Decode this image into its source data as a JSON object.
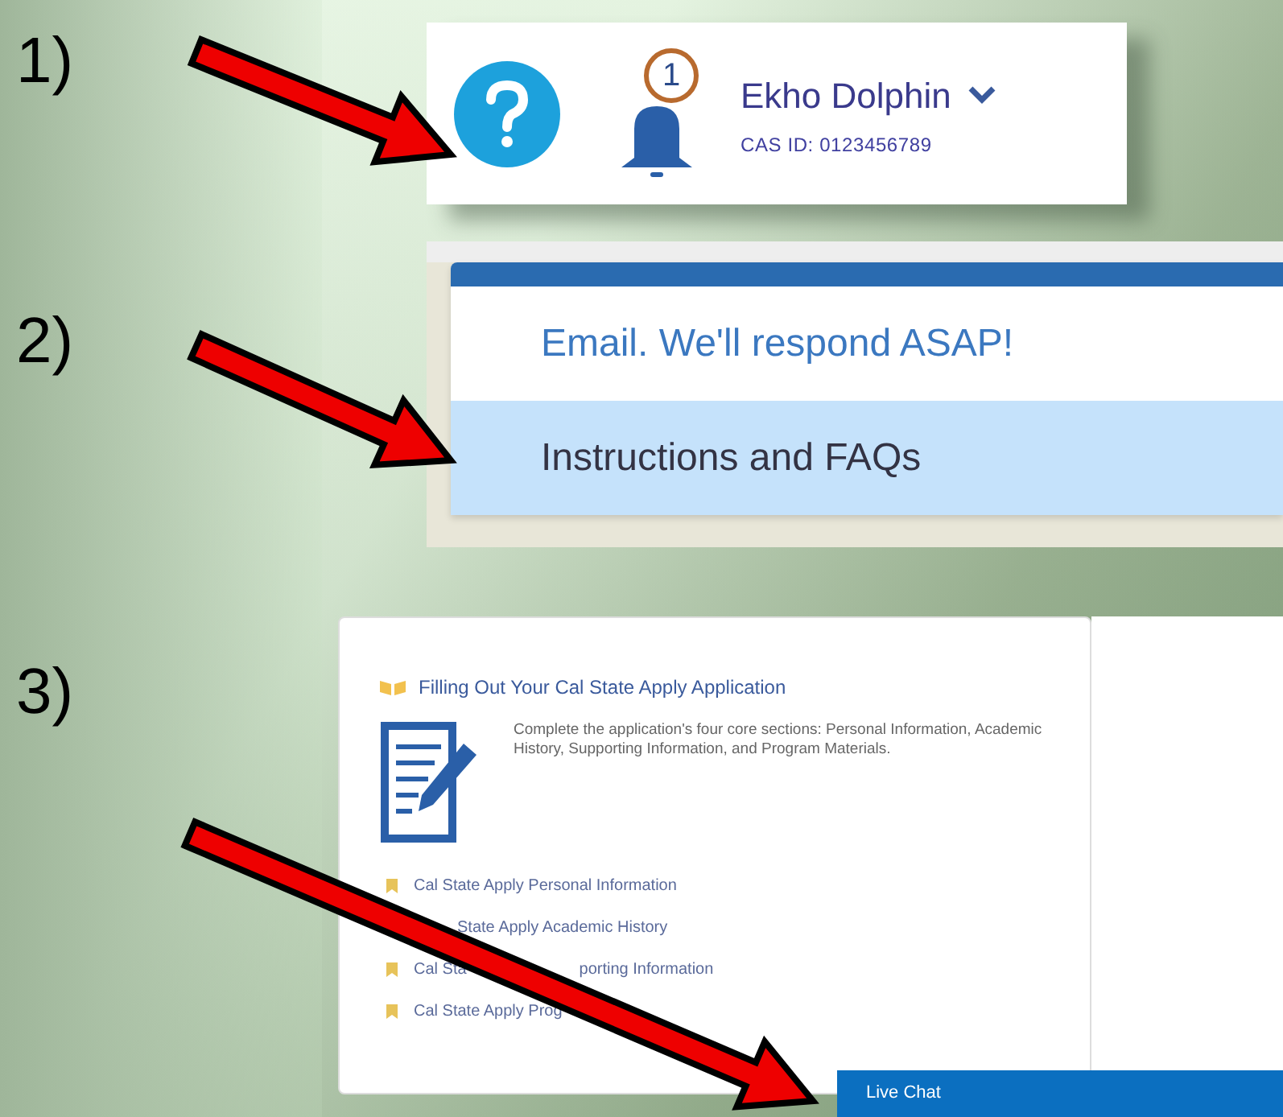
{
  "steps": [
    {
      "label": "1)"
    },
    {
      "label": "2)"
    },
    {
      "label": "3)"
    }
  ],
  "header": {
    "notification_count": "1",
    "user_name": "Ekho Dolphin",
    "cas_id": "CAS ID: 0123456789"
  },
  "help_menu": {
    "items": [
      {
        "label": "Email. We'll respond ASAP!",
        "selected": false
      },
      {
        "label": "Instructions and FAQs",
        "selected": true
      }
    ]
  },
  "card": {
    "title": "Filling Out Your Cal State Apply Application",
    "description": "Complete the application's four core sections: Personal Information, Academic History, Supporting Information, and Program Materials.",
    "links": [
      {
        "bullet": true,
        "parts": [
          "Cal State Apply Personal Information"
        ]
      },
      {
        "bullet": false,
        "parts": [
          "State Apply Academic History"
        ]
      },
      {
        "bullet": true,
        "parts": [
          "Cal Sta",
          "porting Information"
        ]
      },
      {
        "bullet": true,
        "parts": [
          "Cal State Apply Prog"
        ]
      }
    ]
  },
  "live_chat": {
    "label": "Live Chat"
  }
}
